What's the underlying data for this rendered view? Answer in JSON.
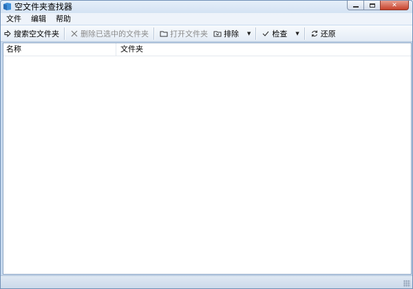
{
  "window": {
    "title": "空文件夹查找器"
  },
  "menu": {
    "items": [
      "文件",
      "编辑",
      "帮助"
    ]
  },
  "toolbar": {
    "search": "搜索空文件夹",
    "delete_selected": "删除已选中的文件夹",
    "open_folder": "打开文件夹",
    "exclude": "排除",
    "check": "检查",
    "restore": "还原"
  },
  "list": {
    "columns": [
      "名称",
      "文件夹"
    ],
    "rows": []
  },
  "colors": {
    "accent": "#c8daef",
    "close": "#c7412a"
  }
}
